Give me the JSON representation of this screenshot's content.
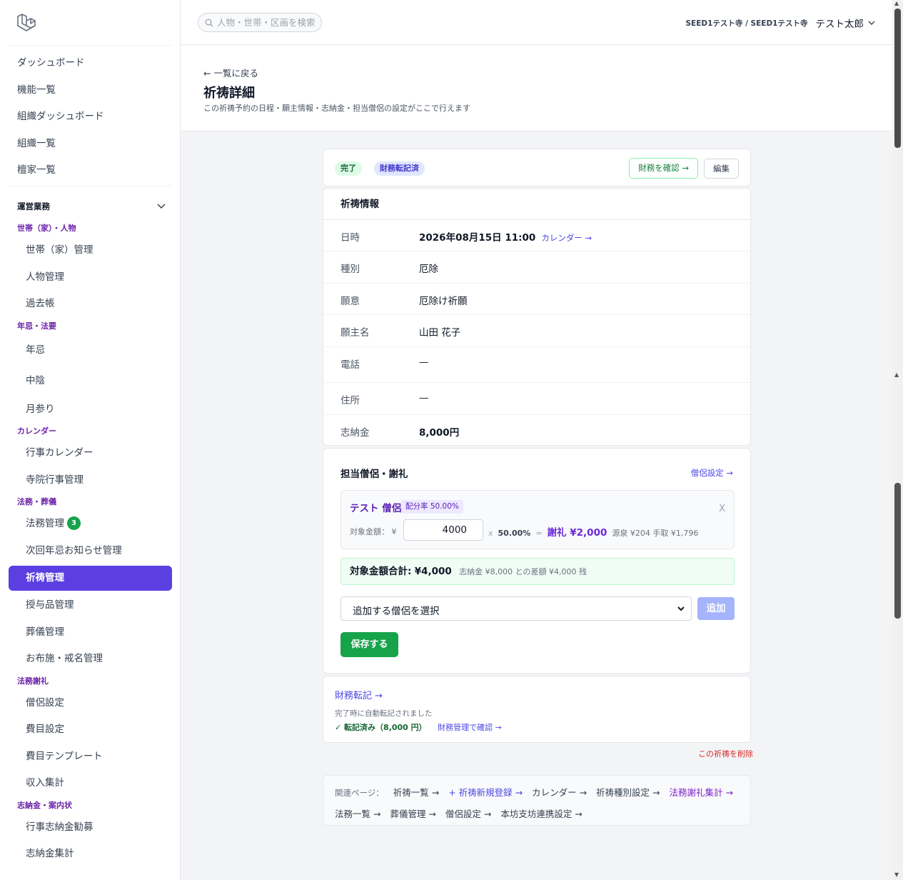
{
  "search": {
    "placeholder": "人物・世帯・区画を検索"
  },
  "header": {
    "org": "SEED1テスト寺 / SEED1テスト寺",
    "user": "テスト太郎"
  },
  "sidebar": {
    "top_items": [
      "ダッシュボード",
      "機能一覧",
      "組織ダッシュボード",
      "組織一覧",
      "檀家一覧"
    ],
    "section_label": "運営業務",
    "groups": [
      {
        "label": "世帯（家）・人物",
        "items": [
          "世帯（家）管理",
          "人物管理",
          "過去帳"
        ]
      },
      {
        "label": "年忌・法要",
        "items": [
          "年忌",
          "中陰",
          "月参り"
        ]
      },
      {
        "label": "カレンダー",
        "items": [
          "行事カレンダー",
          "寺院行事管理"
        ]
      },
      {
        "label": "法務・葬儀",
        "items": [
          "法務管理",
          "次回年忌お知らせ管理",
          "祈祷管理",
          "授与品管理",
          "葬儀管理",
          "お布施・戒名管理"
        ]
      },
      {
        "label": "法務謝礼",
        "items": [
          "僧侶設定",
          "費目設定",
          "費目テンプレート",
          "収入集計"
        ]
      },
      {
        "label": "志納金・案内状",
        "items": [
          "行事志納金勧募",
          "志納金集計"
        ]
      }
    ],
    "houmu_badge": "3",
    "active_item": "祈祷管理"
  },
  "page": {
    "back_link": "← 一覧に戻る",
    "title": "祈祷詳細",
    "subtitle": "この祈祷予約の日程・願主情報・志納金・担当僧侶の設定がここで行えます"
  },
  "status": {
    "badge_done": "完了",
    "badge_finance": "財務転記済",
    "check_finance_button": "財務を確認 →",
    "edit_button": "編集"
  },
  "info": {
    "title": "祈祷情報",
    "rows": [
      {
        "key": "日時",
        "value": "2026年08月15日 11:00",
        "link": "カレンダー →"
      },
      {
        "key": "種別",
        "value": "厄除"
      },
      {
        "key": "願意",
        "value": "厄除け祈願"
      },
      {
        "key": "願主名",
        "value": "山田 花子"
      },
      {
        "key": "電話",
        "value": "—"
      },
      {
        "key": "住所",
        "value": "—"
      },
      {
        "key": "志納金",
        "value": "8,000円"
      }
    ]
  },
  "priests": {
    "title": "担当僧侶・謝礼",
    "settings_link": "僧侶設定 →",
    "entry": {
      "name": "テスト 僧侶",
      "rate": "配分率 50.00%",
      "remove": "X",
      "amount_label": "対象金額：",
      "currency": "¥",
      "amount_value": "4000",
      "times": "x",
      "percent": "50.00%",
      "equals": "=",
      "fee": "謝礼 ¥2,000",
      "tax": "源泉 ¥204 手取 ¥1,796"
    },
    "total_label": "対象金額合計:",
    "total_value": "¥4,000",
    "total_diff": "志納金 ¥8,000 との差額 ¥4,000 残",
    "select_placeholder": "追加する僧侶を選択",
    "add_button": "追加",
    "save_button": "保存する"
  },
  "finance": {
    "title": "財務転記 →",
    "note": "完了時に自動転記されました",
    "status": "✓ 転記済み（8,000 円）",
    "link": "財務管理で確認 →"
  },
  "delete_link": "この祈祷を削除",
  "related": {
    "label": "関連ページ：",
    "line1": [
      "祈祷一覧 →",
      "+ 祈祷新規登録 →",
      "カレンダー →",
      "祈祷種別設定 →",
      "法務謝礼集計 →"
    ],
    "line2": [
      "法務一覧 →",
      "葬儀管理 →",
      "僧侶設定 →",
      "本坊支坊連携設定 →"
    ]
  },
  "colors": {
    "accent": "#5b3fe0",
    "success": "#16a34a",
    "link": "#4f46e5",
    "danger": "#dc2626"
  }
}
